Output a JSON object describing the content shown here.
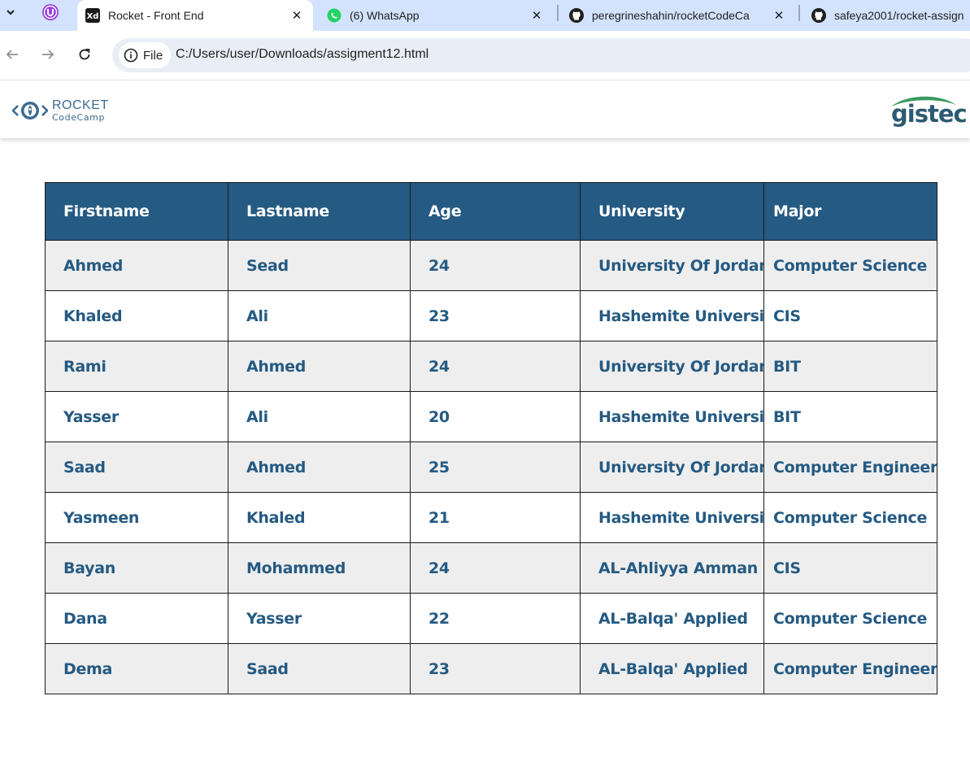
{
  "browser": {
    "tabs": [
      {
        "title": "Rocket - Front End",
        "favicon": "xd-icon",
        "active": true
      },
      {
        "title": "(6) WhatsApp",
        "favicon": "whatsapp-icon",
        "active": false
      },
      {
        "title": "peregrineshahin/rocketCodeCa",
        "favicon": "github-icon",
        "active": false
      },
      {
        "title": "safeya2001/rocket-assign",
        "favicon": "github-icon",
        "active": false
      }
    ],
    "site_info_label": "File",
    "url": "C:/Users/user/Downloads/assigment12.html"
  },
  "header": {
    "logo_line1": "ROCKET",
    "logo_line2": "CodeCamp",
    "partner_logo": "gistec"
  },
  "table": {
    "headers": [
      "Firstname",
      "Lastname",
      "Age",
      "University",
      "Major"
    ],
    "rows": [
      [
        "Ahmed",
        "Sead",
        "24",
        "University Of Jordan",
        "Computer Science"
      ],
      [
        "Khaled",
        "Ali",
        "23",
        "Hashemite University",
        "CIS"
      ],
      [
        "Rami",
        "Ahmed",
        "24",
        "University Of Jordan",
        "BIT"
      ],
      [
        "Yasser",
        "Ali",
        "20",
        "Hashemite University",
        "BIT"
      ],
      [
        "Saad",
        "Ahmed",
        "25",
        "University Of Jordan",
        "Computer Engineering"
      ],
      [
        "Yasmeen",
        "Khaled",
        "21",
        "Hashemite University",
        "Computer Science"
      ],
      [
        "Bayan",
        "Mohammed",
        "24",
        "AL-Ahliyya Amman",
        "CIS"
      ],
      [
        "Dana",
        "Yasser",
        "22",
        "AL-Balqa' Applied",
        "Computer Science"
      ],
      [
        "Dema",
        "Saad",
        "23",
        "AL-Balqa' Applied",
        "Computer Engineering"
      ]
    ]
  },
  "colors": {
    "header_bg": "#255a82",
    "cell_text": "#255a82",
    "stripe": "#eeeeee",
    "tabstrip": "#d3e3fd"
  }
}
